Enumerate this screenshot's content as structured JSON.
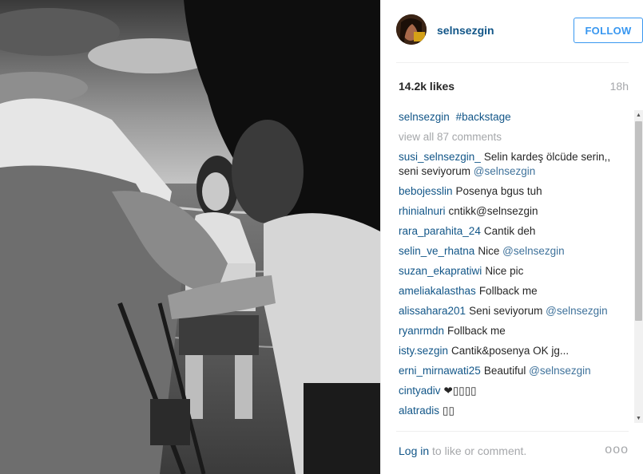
{
  "post": {
    "username": "selnsezgin",
    "follow_label": "FOLLOW",
    "likes": "14.2k likes",
    "time": "18h"
  },
  "caption": {
    "user": "selnsezgin",
    "text": "#backstage"
  },
  "view_all": "view all 87 comments",
  "comments": [
    {
      "user": "susi_selnsezgin_",
      "text": "Selin kardeş ölcüde serin,, seni seviyorum",
      "mention": "@selnsezgin"
    },
    {
      "user": "bebojesslin",
      "text": "Posenya bgus tuh",
      "mention": ""
    },
    {
      "user": "rhinialnuri",
      "text": "cntikk@selnsezgin",
      "mention": ""
    },
    {
      "user": "rara_parahita_24",
      "text": "Cantik deh",
      "mention": ""
    },
    {
      "user": "selin_ve_rhatna",
      "text": "Nice",
      "mention": "@selnsezgin"
    },
    {
      "user": "suzan_ekapratiwi",
      "text": "Nice pic",
      "mention": ""
    },
    {
      "user": "ameliakalasthas",
      "text": "Follback me",
      "mention": ""
    },
    {
      "user": "alissahara201",
      "text": "Seni seviyorum",
      "mention": "@selnsezgin"
    },
    {
      "user": "ryanrmdn",
      "text": "Follback me",
      "mention": ""
    },
    {
      "user": "isty.sezgin",
      "text": "Cantik&posenya OK jg...",
      "mention": ""
    },
    {
      "user": "erni_mirnawati25",
      "text": "Beautiful",
      "mention": "@selnsezgin"
    },
    {
      "user": "cintyadiv",
      "text": "❤▯▯▯▯",
      "mention": ""
    },
    {
      "user": "alatradis",
      "text": "▯▯",
      "mention": ""
    }
  ],
  "footer": {
    "login_label": "Log in",
    "login_rest": " to like or comment.",
    "more_label": "ooo"
  },
  "icons": {
    "more": "ellipsis-icon",
    "scroll_up": "scroll-up-arrow-icon",
    "scroll_down": "scroll-down-arrow-icon"
  },
  "colors": {
    "link": "#125688",
    "follow": "#3897f0",
    "muted": "#a5a7aa"
  }
}
